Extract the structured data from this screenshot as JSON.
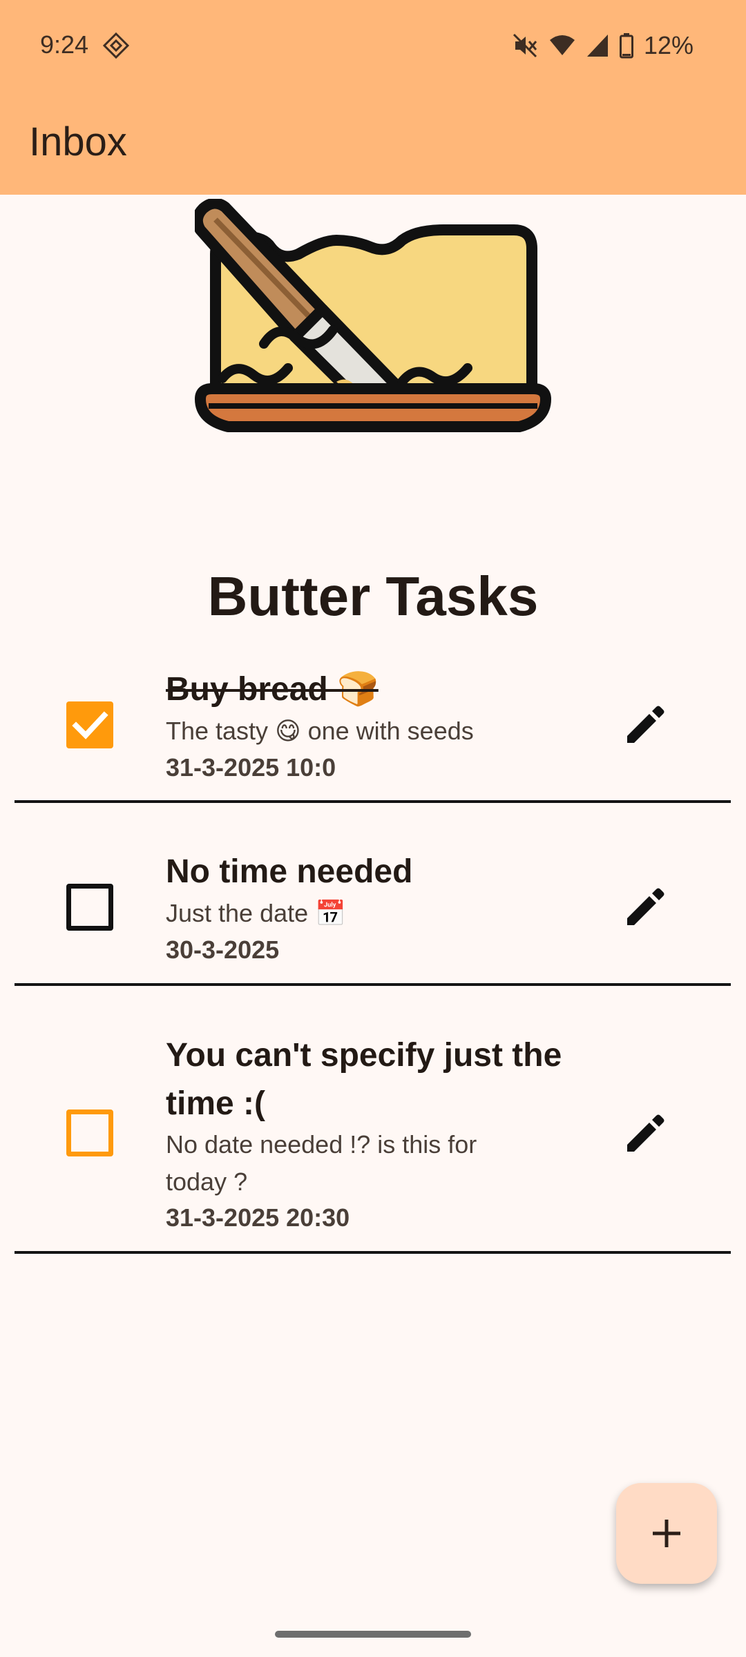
{
  "status_bar": {
    "time": "9:24",
    "battery_percent": "12%",
    "icons": [
      "assistant-diamond-icon",
      "mute-icon",
      "wifi-icon",
      "signal-icon",
      "battery-icon"
    ]
  },
  "app_bar": {
    "title": "Inbox"
  },
  "header": {
    "app_name": "Butter Tasks",
    "logo": "butter-knife-logo"
  },
  "tasks": [
    {
      "title": "Buy bread 🍞",
      "description": "The tasty 😋 one with seeds",
      "date": "31-3-2025 10:0",
      "completed": true
    },
    {
      "title": "No time needed",
      "description": "Just the date 📅",
      "date": "30-3-2025",
      "completed": false
    },
    {
      "title": "You can't specify just the time :(",
      "description": "No date needed !? is this for today ?",
      "date": "31-3-2025 20:30",
      "completed": false
    }
  ],
  "fab": {
    "icon": "plus-icon"
  },
  "colors": {
    "app_bar": "#ffb779",
    "background": "#fff8f5",
    "accent": "#ff9a0c",
    "fab_background": "#ffdbc5"
  }
}
